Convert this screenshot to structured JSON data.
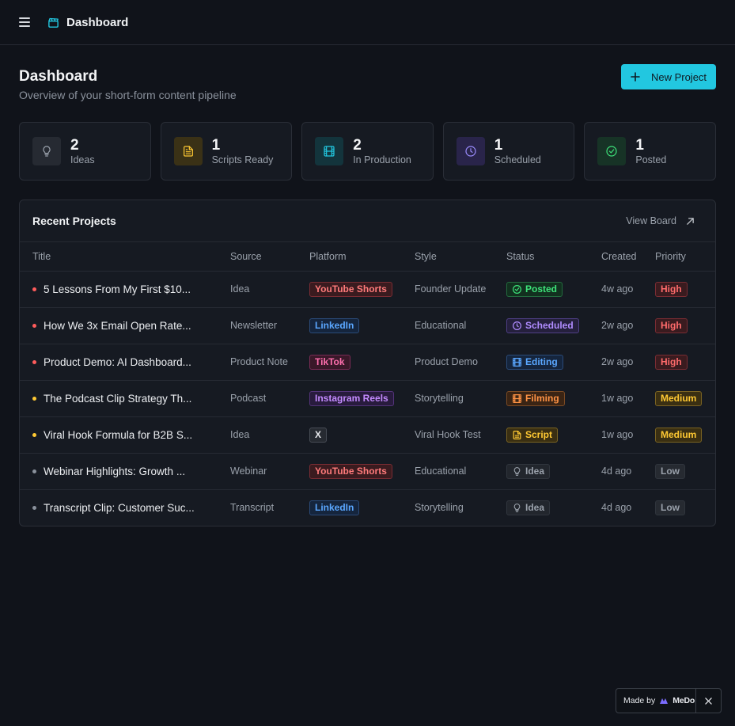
{
  "topbar": {
    "title": "Dashboard",
    "menu_icon": "hamburger-icon",
    "brand_icon": "clapperboard-icon"
  },
  "header": {
    "title": "Dashboard",
    "subtitle": "Overview of your short-form content pipeline",
    "new_project_label": "New Project"
  },
  "stats": [
    {
      "count": "2",
      "label": "Ideas",
      "icon": "lightbulb-icon",
      "color": "#9aa1ab"
    },
    {
      "count": "1",
      "label": "Scripts Ready",
      "icon": "document-icon",
      "color": "#ffc933"
    },
    {
      "count": "2",
      "label": "In Production",
      "icon": "film-icon",
      "color": "#22c7e0"
    },
    {
      "count": "1",
      "label": "Scheduled",
      "icon": "clock-icon",
      "color": "#9b8cff"
    },
    {
      "count": "1",
      "label": "Posted",
      "icon": "check-circle-icon",
      "color": "#3ee37a"
    }
  ],
  "recent": {
    "title": "Recent Projects",
    "view_board_label": "View Board",
    "columns": [
      "Title",
      "Source",
      "Platform",
      "Style",
      "Status",
      "Created",
      "Priority"
    ],
    "rows": [
      {
        "title": "5 Lessons From My First $10...",
        "source": "Idea",
        "platform": "YouTube Shorts",
        "style": "Founder Update",
        "status": "Posted",
        "created": "4w ago",
        "priority": "High"
      },
      {
        "title": "How We 3x Email Open Rate...",
        "source": "Newsletter",
        "platform": "LinkedIn",
        "style": "Educational",
        "status": "Scheduled",
        "created": "2w ago",
        "priority": "High"
      },
      {
        "title": "Product Demo: AI Dashboard...",
        "source": "Product Note",
        "platform": "TikTok",
        "style": "Product Demo",
        "status": "Editing",
        "created": "2w ago",
        "priority": "High"
      },
      {
        "title": "The Podcast Clip Strategy Th...",
        "source": "Podcast",
        "platform": "Instagram Reels",
        "style": "Storytelling",
        "status": "Filming",
        "created": "1w ago",
        "priority": "Medium"
      },
      {
        "title": "Viral Hook Formula for B2B S...",
        "source": "Idea",
        "platform": "X",
        "style": "Viral Hook Test",
        "status": "Script",
        "created": "1w ago",
        "priority": "Medium"
      },
      {
        "title": "Webinar Highlights: Growth ...",
        "source": "Webinar",
        "platform": "YouTube Shorts",
        "style": "Educational",
        "status": "Idea",
        "created": "4d ago",
        "priority": "Low"
      },
      {
        "title": "Transcript Clip: Customer Suc...",
        "source": "Transcript",
        "platform": "LinkedIn",
        "style": "Storytelling",
        "status": "Idea",
        "created": "4d ago",
        "priority": "Low"
      }
    ]
  },
  "made_by": {
    "prefix": "Made by",
    "brand": "MeDo",
    "close_icon": "close-icon"
  },
  "colors": {
    "accent": "#22c7e0",
    "background": "#10131a",
    "surface": "#161a22"
  }
}
